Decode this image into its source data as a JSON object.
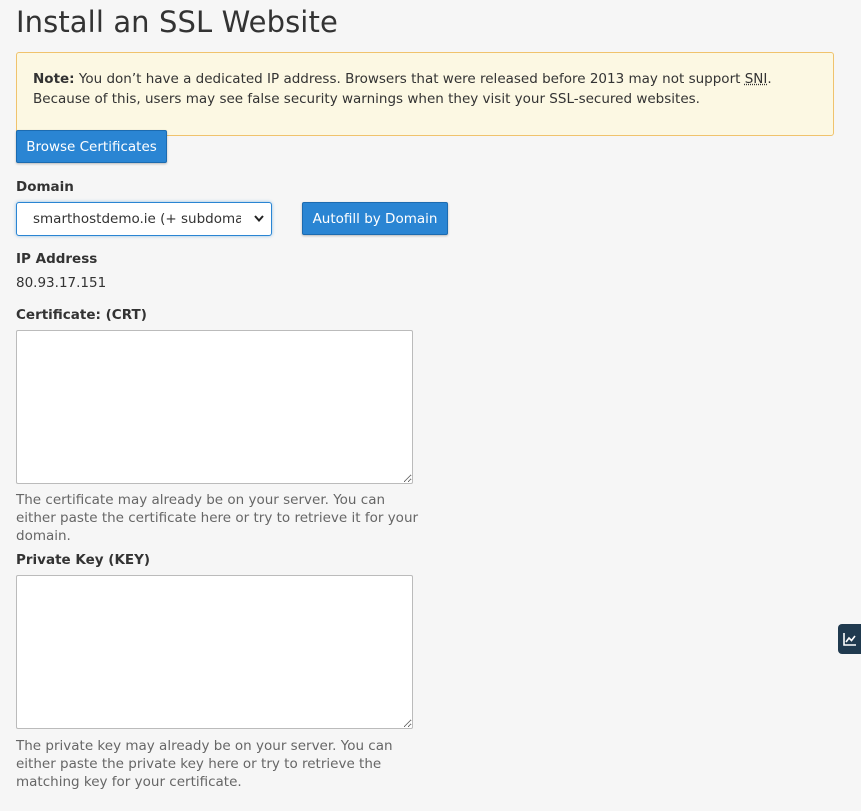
{
  "page_title": "Install an SSL Website",
  "notice": {
    "label": "Note:",
    "text_before": " You don’t have a dedicated IP address. Browsers that were released before 2013 may not support ",
    "abbr": "SNI",
    "text_after": ". Because of this, users may see false security warnings when they visit your SSL-secured websites."
  },
  "browse_button": "Browse Certificates",
  "domain": {
    "label": "Domain",
    "selected": "smarthostdemo.ie    (+ subdomains)",
    "autofill_button": "Autofill by Domain"
  },
  "ip": {
    "label": "IP Address",
    "value": "80.93.17.151"
  },
  "certificate": {
    "label": "Certificate: (CRT)",
    "value": "",
    "help": "The certificate may already be on your server. You can either paste the certificate here or try to retrieve it for your domain."
  },
  "private_key": {
    "label": "Private Key (KEY)",
    "value": "",
    "help": "The private key may already be on your server. You can either paste the private key here or try to retrieve the matching key for your certificate."
  },
  "side_tab_icon": "chart-line-icon",
  "colors": {
    "primary": "#2a85d3",
    "alert_bg": "#fcf8e3",
    "alert_border": "#f0c36d",
    "side_tab": "#203a4f"
  }
}
